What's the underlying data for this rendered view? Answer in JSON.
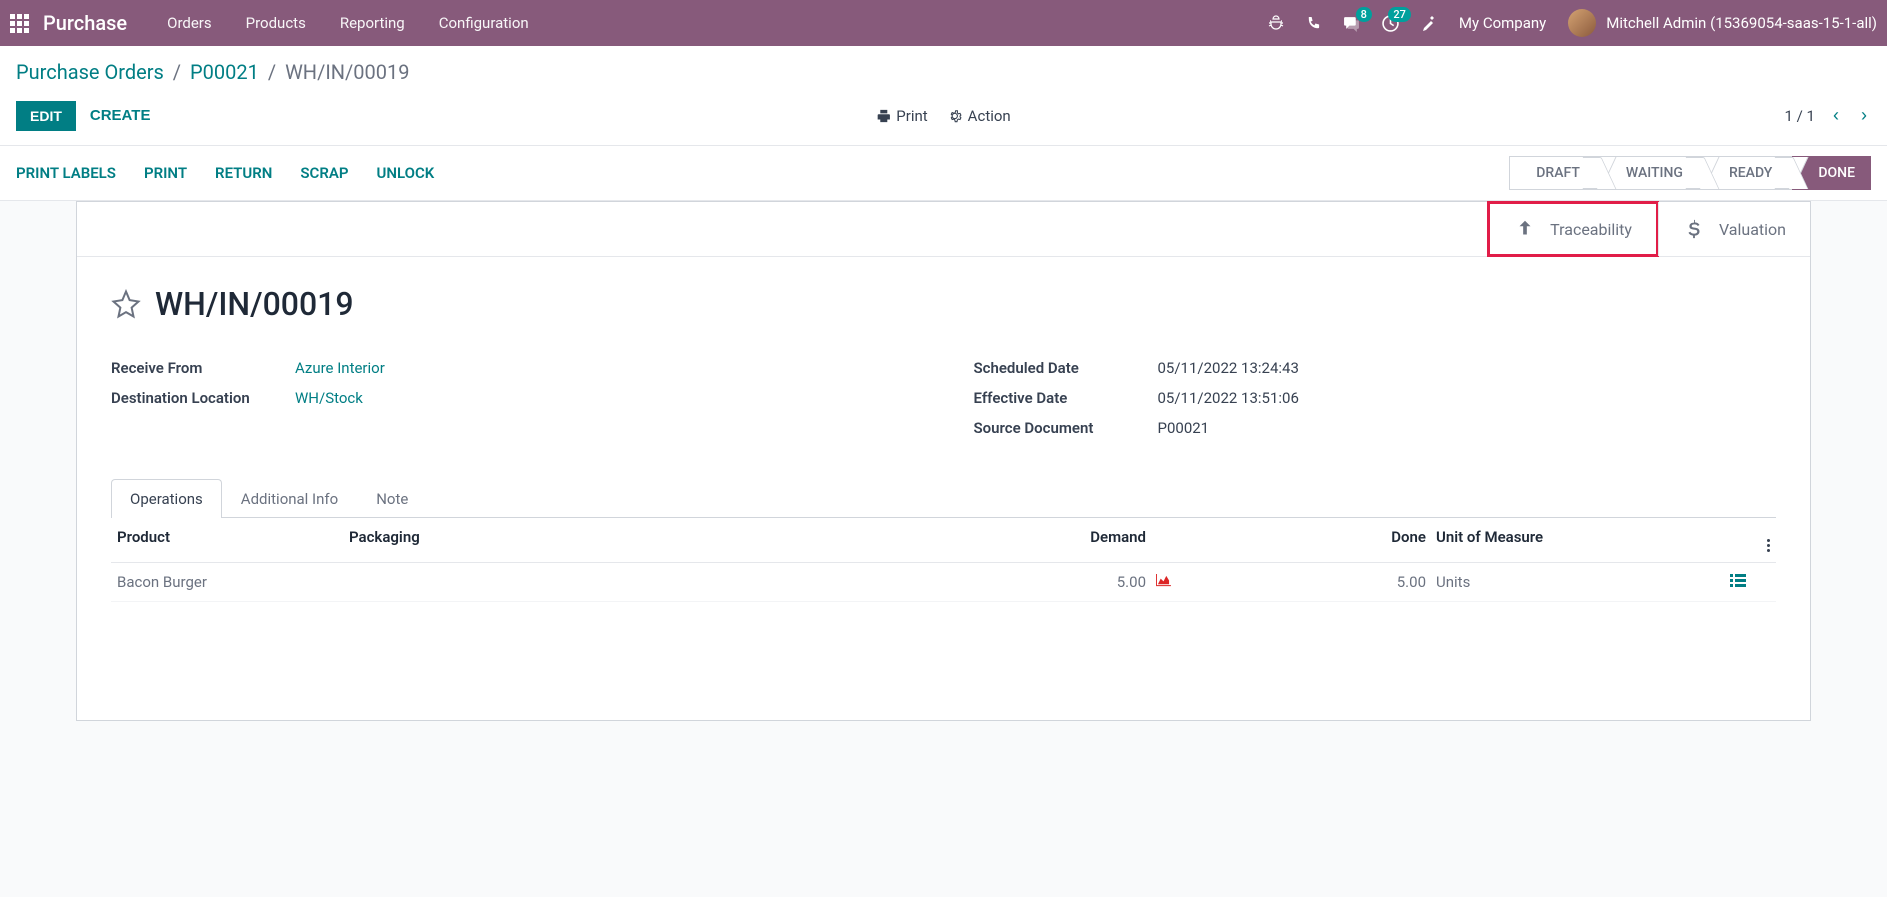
{
  "topbar": {
    "app_name": "Purchase",
    "menu": [
      "Orders",
      "Products",
      "Reporting",
      "Configuration"
    ],
    "msg_badge": "8",
    "activity_badge": "27",
    "company": "My Company",
    "user": "Mitchell Admin (15369054-saas-15-1-all)"
  },
  "breadcrumb": {
    "level1": "Purchase Orders",
    "level2": "P00021",
    "current": "WH/IN/00019"
  },
  "toolbar": {
    "edit": "EDIT",
    "create": "CREATE",
    "print": "Print",
    "action": "Action",
    "pager": "1 / 1"
  },
  "actions": {
    "print_labels": "PRINT LABELS",
    "print": "PRINT",
    "return": "RETURN",
    "scrap": "SCRAP",
    "unlock": "UNLOCK"
  },
  "status": {
    "draft": "DRAFT",
    "waiting": "WAITING",
    "ready": "READY",
    "done": "DONE"
  },
  "stat_buttons": {
    "traceability": "Traceability",
    "valuation": "Valuation"
  },
  "record": {
    "name": "WH/IN/00019",
    "receive_from_label": "Receive From",
    "receive_from": "Azure Interior",
    "dest_label": "Destination Location",
    "dest": "WH/Stock",
    "scheduled_label": "Scheduled Date",
    "scheduled": "05/11/2022 13:24:43",
    "effective_label": "Effective Date",
    "effective": "05/11/2022 13:51:06",
    "source_label": "Source Document",
    "source": "P00021"
  },
  "tabs": {
    "operations": "Operations",
    "additional": "Additional Info",
    "note": "Note"
  },
  "grid": {
    "headers": {
      "product": "Product",
      "packaging": "Packaging",
      "demand": "Demand",
      "done": "Done",
      "uom": "Unit of Measure"
    },
    "rows": [
      {
        "product": "Bacon Burger",
        "packaging": "",
        "demand": "5.00",
        "done": "5.00",
        "uom": "Units"
      }
    ]
  }
}
